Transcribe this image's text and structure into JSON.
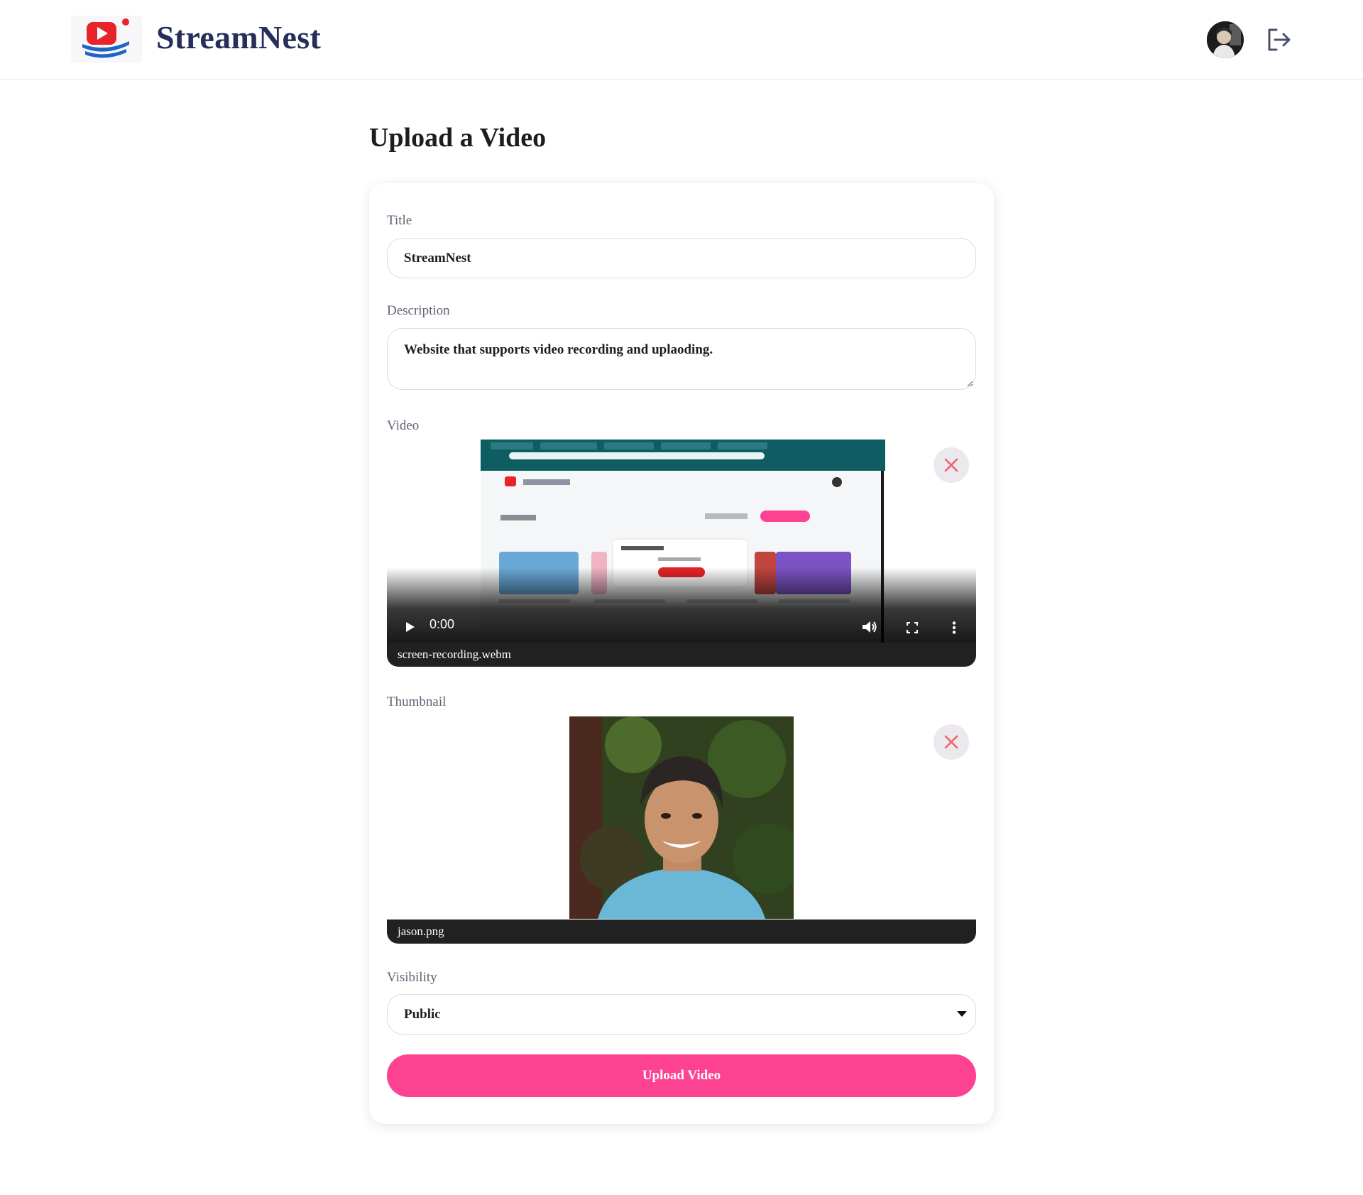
{
  "header": {
    "brand": "StreamNest",
    "logo_icon": "streamnest-logo-icon",
    "avatar_icon": "user-avatar",
    "logout_icon": "logout-icon"
  },
  "page": {
    "title": "Upload a Video"
  },
  "form": {
    "title_label": "Title",
    "title_value": "StreamNest",
    "description_label": "Description",
    "description_value": "Website that supports video recording and uplaoding.",
    "video_label": "Video",
    "video": {
      "current_time": "0:00",
      "file_name": "screen-recording.webm",
      "play_icon": "play-icon",
      "volume_icon": "volume-icon",
      "fullscreen_icon": "fullscreen-icon",
      "more_icon": "more-vertical-icon",
      "remove_icon": "close-icon"
    },
    "thumbnail_label": "Thumbnail",
    "thumbnail": {
      "file_name": "jason.png",
      "remove_icon": "close-icon"
    },
    "visibility_label": "Visibility",
    "visibility_value": "Public",
    "submit_label": "Upload Video"
  },
  "colors": {
    "accent": "#fe4292",
    "brand_text": "#262e5c",
    "logo_red": "#e8232a",
    "logo_blue": "#1e63c5",
    "remove_x": "#f2606a"
  }
}
